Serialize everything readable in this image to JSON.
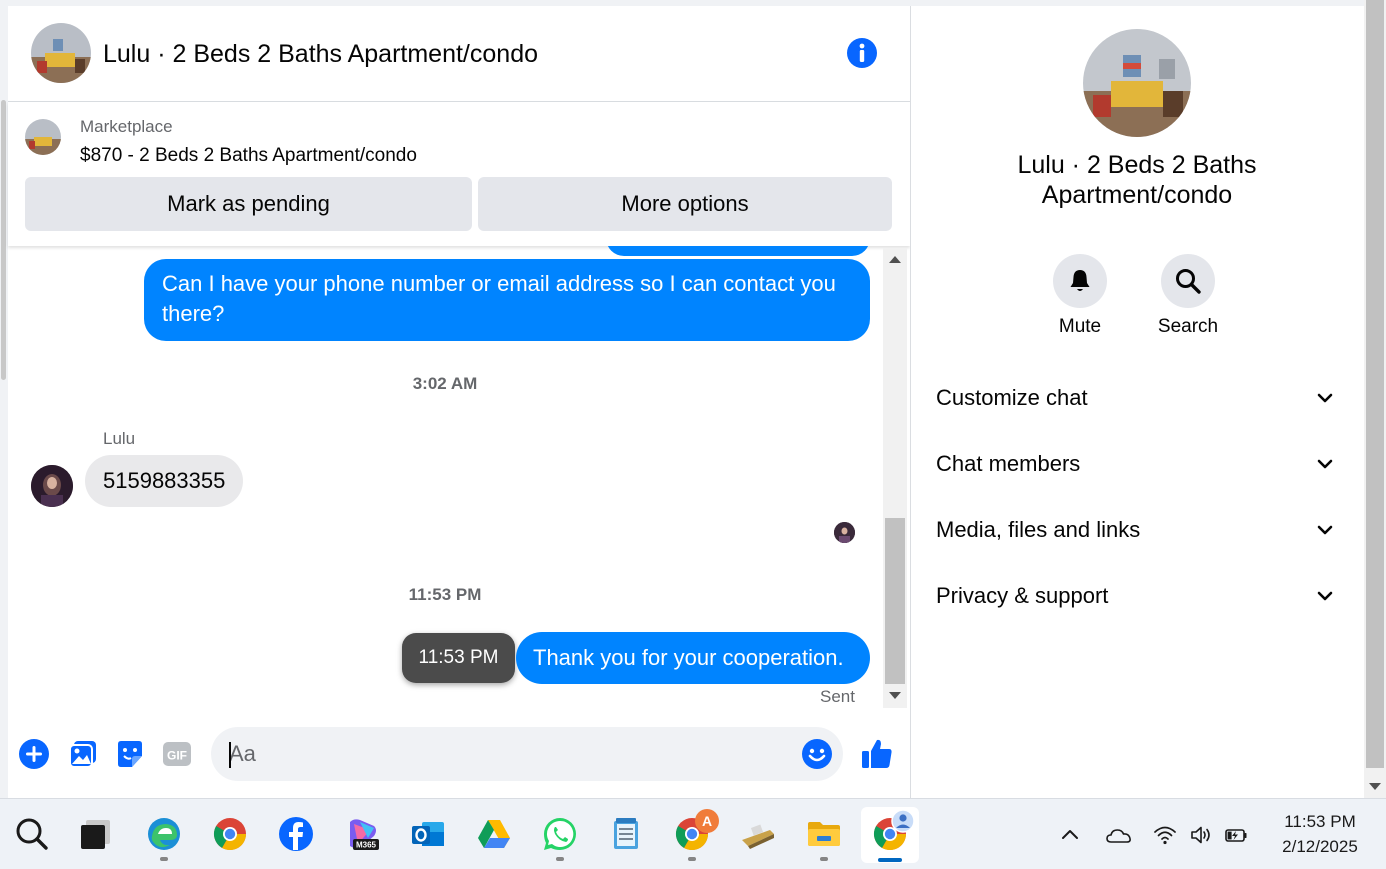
{
  "chat": {
    "title": "Lulu · 2 Beds 2 Baths Apartment/condo",
    "marketplace_label": "Marketplace",
    "listing": "$870 - 2 Beds 2 Baths Apartment/condo",
    "mark_pending_label": "Mark as pending",
    "more_options_label": "More options"
  },
  "messages": {
    "outgoing_1": "Can I have your phone number or email address so I can contact you there?",
    "time_1": "3:02 AM",
    "sender_name": "Lulu",
    "incoming_1": "5159883355",
    "time_2": "11:53 PM",
    "tooltip_time": "11:53 PM",
    "outgoing_2": "Thank you for your cooperation.",
    "status": "Sent"
  },
  "composer": {
    "placeholder": "Aa"
  },
  "panel": {
    "title": "Lulu · 2 Beds 2 Baths Apartment/condo",
    "mute_label": "Mute",
    "search_label": "Search",
    "sections": [
      "Customize chat",
      "Chat members",
      "Media, files and links",
      "Privacy & support"
    ]
  },
  "taskbar": {
    "time": "11:53 PM",
    "date": "2/12/2025",
    "m365_badge": "M365",
    "notification_badge": "A"
  },
  "colors": {
    "accent": "#0084ff",
    "icon_blue": "#0866ff",
    "bubble_in": "#e9e9eb"
  }
}
